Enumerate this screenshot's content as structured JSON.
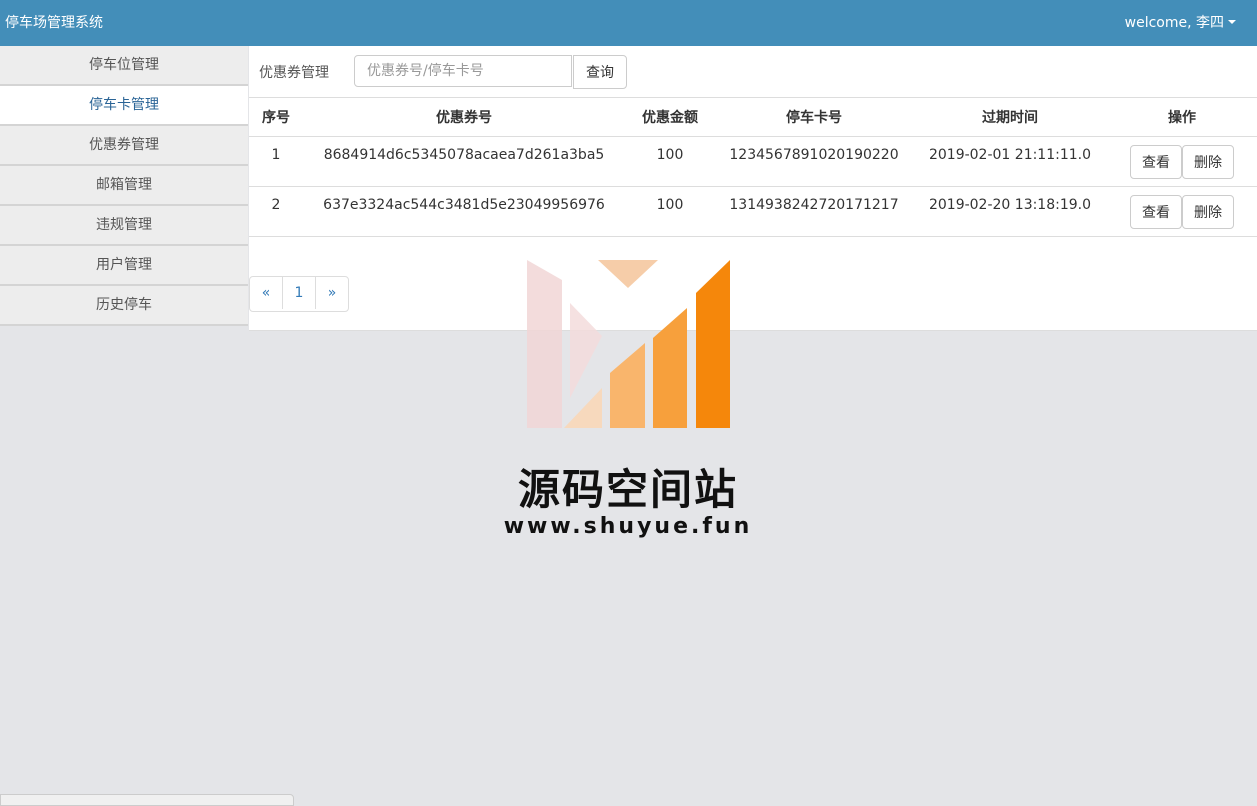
{
  "header": {
    "title": "停车场管理系统",
    "user_greeting": "welcome, 李四"
  },
  "sidebar": {
    "items": [
      {
        "label": "停车位管理"
      },
      {
        "label": "停车卡管理"
      },
      {
        "label": "优惠券管理"
      },
      {
        "label": "邮箱管理"
      },
      {
        "label": "违规管理"
      },
      {
        "label": "用户管理"
      },
      {
        "label": "历史停车"
      }
    ],
    "active_index": 1
  },
  "toolbar": {
    "label": "优惠券管理",
    "search_placeholder": "优惠券号/停车卡号",
    "search_button": "查询"
  },
  "table": {
    "headers": [
      "序号",
      "优惠券号",
      "优惠金额",
      "停车卡号",
      "过期时间",
      "操作"
    ],
    "rows": [
      {
        "index": "1",
        "coupon": "8684914d6c5345078acaea7d261a3ba5",
        "amount": "100",
        "card": "1234567891020190220",
        "expires": "2019-02-01 21:11:11.0"
      },
      {
        "index": "2",
        "coupon": "637e3324ac544c3481d5e23049956976",
        "amount": "100",
        "card": "1314938242720171217",
        "expires": "2019-02-20 13:18:19.0"
      }
    ],
    "actions": {
      "view": "查看",
      "delete": "删除"
    }
  },
  "pagination": {
    "prev": "«",
    "page": "1",
    "next": "»"
  },
  "watermark": {
    "title": "源码空间站",
    "url": "www.shuyue.fun"
  },
  "colors": {
    "header_bg": "#438eb9",
    "page_bg": "#e4e5e8",
    "link": "#337ab7"
  }
}
